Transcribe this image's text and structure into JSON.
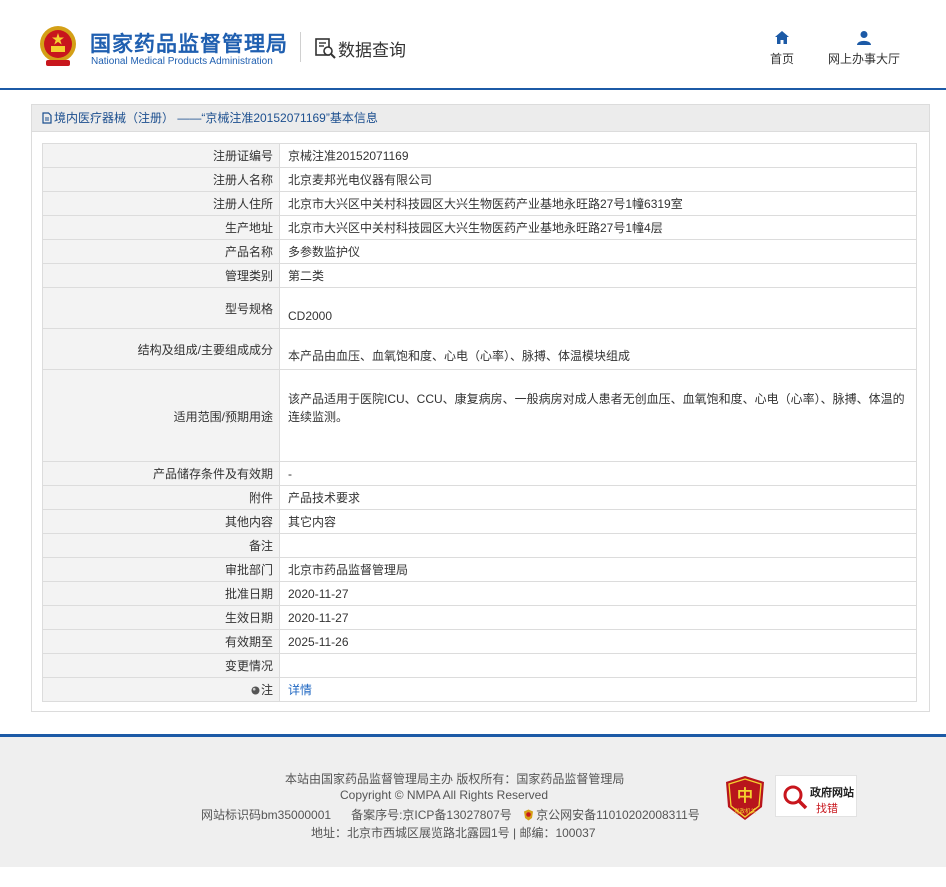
{
  "header": {
    "logo_cn": "国家药品监督管理局",
    "logo_en": "National Medical Products Administration",
    "section_title": "数据查询",
    "nav": [
      {
        "label": "首页",
        "icon": "home-icon"
      },
      {
        "label": "网上办事大厅",
        "icon": "user-icon"
      }
    ]
  },
  "panel": {
    "title": "境内医疗器械（注册） ——“京械注准20152071169”基本信息",
    "rows": [
      {
        "label": "注册证编号",
        "value": "京械注准20152071169"
      },
      {
        "label": "注册人名称",
        "value": "北京麦邦光电仪器有限公司"
      },
      {
        "label": "注册人住所",
        "value": "北京市大兴区中关村科技园区大兴生物医药产业基地永旺路27号1幢6319室"
      },
      {
        "label": "生产地址",
        "value": "北京市大兴区中关村科技园区大兴生物医药产业基地永旺路27号1幢4层"
      },
      {
        "label": "产品名称",
        "value": "多参数监护仪"
      },
      {
        "label": "管理类别",
        "value": "第二类"
      },
      {
        "label": "型号规格",
        "value": "CD2000"
      },
      {
        "label": "结构及组成/主要组成成分",
        "value": "本产品由血压、血氧饱和度、心电（心率）、脉搏、体温模块组成"
      },
      {
        "label": "适用范围/预期用途",
        "value": "该产品适用于医院ICU、CCU、康复病房、一般病房对成人患者无创血压、血氧饱和度、心电（心率）、脉搏、体温的连续监测。"
      },
      {
        "label": "产品储存条件及有效期",
        "value": "-"
      },
      {
        "label": "附件",
        "value": "产品技术要求"
      },
      {
        "label": "其他内容",
        "value": "其它内容"
      },
      {
        "label": "备注",
        "value": ""
      },
      {
        "label": "审批部门",
        "value": "北京市药品监督管理局"
      },
      {
        "label": "批准日期",
        "value": "2020-11-27"
      },
      {
        "label": "生效日期",
        "value": "2020-11-27"
      },
      {
        "label": "有效期至",
        "value": "2025-11-26"
      },
      {
        "label": "变更情况",
        "value": ""
      },
      {
        "label": "注",
        "value": "详情"
      }
    ]
  },
  "footer": {
    "line1": "本站由国家药品监督管理局主办 版权所有：国家药品监督管理局",
    "line2": "Copyright © NMPA All Rights Reserved",
    "site_id": "网站标识码bm35000001",
    "icp": "备案序号:京ICP备13027807号",
    "police": "京公网安备11010202008311号",
    "address": "地址：北京市西城区展览路北露园1号 | 邮编：100037",
    "badge_dz_text": "党政机关",
    "gov_badge_line1": "政府网站",
    "gov_badge_line2": "找错"
  },
  "colors": {
    "brand_blue": "#1c5aa6",
    "link_blue": "#1f67c2",
    "label_bg": "#f3f3f3"
  }
}
